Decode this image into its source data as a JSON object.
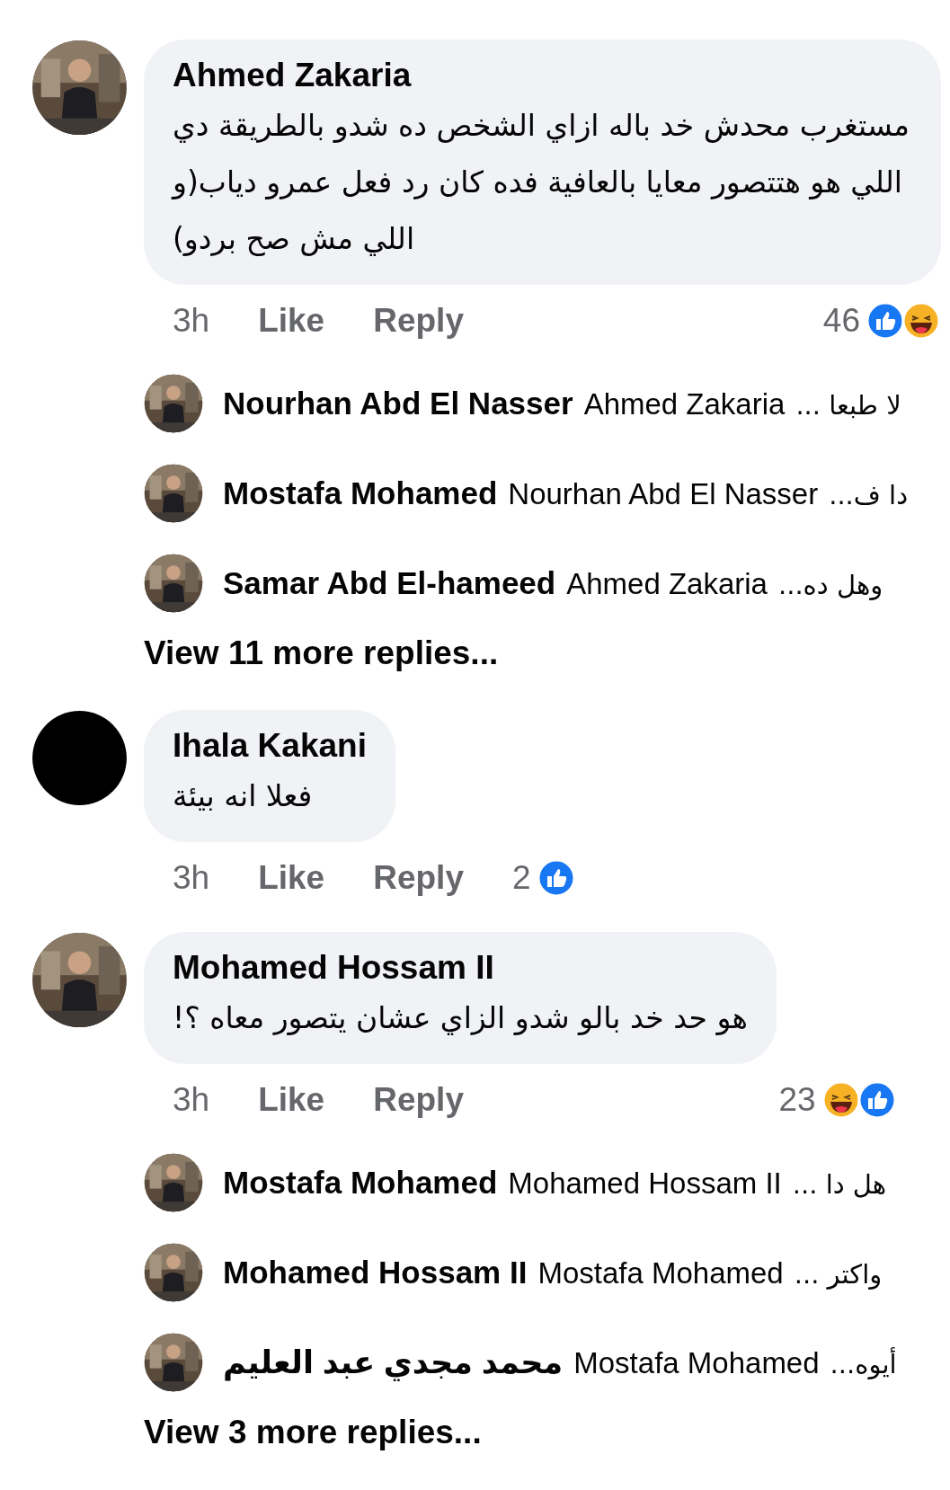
{
  "comments": [
    {
      "author": "Ahmed Zakaria",
      "avatar": {
        "kind": "picture"
      },
      "text": "مستغرب محدش خد باله ازاي الشخص ده شدو بالطريقة دي اللي هو هتتصور معايا بالعافية فده كان رد فعل عمرو دياب(و اللي مش صح بردو)",
      "time": "3h",
      "like": "Like",
      "reply": "Reply",
      "reaction_count": "46",
      "reactions": [
        {
          "kind": "like"
        },
        {
          "kind": "haha"
        }
      ],
      "replies": [
        {
          "author": "Nourhan Abd El Nasser",
          "mention": "Ahmed Zakaria",
          "text": "لا طبعا ..."
        },
        {
          "author": "Mostafa Mohamed",
          "mention": "Nourhan Abd El Nasser",
          "text": "دا ف..."
        },
        {
          "author": "Samar Abd El-hameed",
          "mention": "Ahmed Zakaria",
          "text": "وهل ده..."
        }
      ],
      "more_replies": "View 11 more replies..."
    },
    {
      "author": "Ihala Kakani",
      "avatar": {
        "kind": "empty"
      },
      "text": "فعلا انه بيئة",
      "time": "3h",
      "like": "Like",
      "reply": "Reply",
      "reaction_count": "2",
      "reactions": [
        {
          "kind": "like"
        }
      ]
    },
    {
      "author": "Mohamed Hossam II",
      "avatar": {
        "kind": "picture"
      },
      "text": "هو حد خد بالو شدو الزاي  عشان يتصور معاه ؟!",
      "time": "3h",
      "like": "Like",
      "reply": "Reply",
      "reaction_count": "23",
      "reactions": [
        {
          "kind": "haha"
        },
        {
          "kind": "like"
        }
      ],
      "replies": [
        {
          "author": "Mostafa Mohamed",
          "mention": "Mohamed Hossam II",
          "text": "هل دا ..."
        },
        {
          "author": "Mohamed Hossam II",
          "mention": "Mostafa Mohamed",
          "text": "واكتر ..."
        },
        {
          "author": "محمد مجدي عبد العليم",
          "mention": "Mostafa Mohamed",
          "text": "أيوه..."
        }
      ],
      "more_replies": "View 3 more replies..."
    }
  ]
}
